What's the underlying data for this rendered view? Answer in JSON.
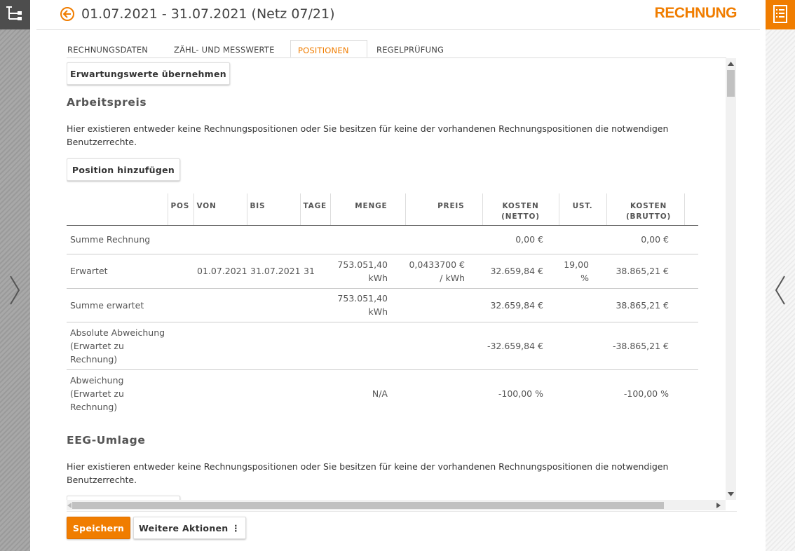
{
  "header": {
    "title": "01.07.2021 - 31.07.2021 (Netz 07/21)",
    "brand": "RECHNUNG",
    "accent_color": "#f07d00"
  },
  "tabs": [
    {
      "label": "RECHNUNGSDATEN",
      "active": false
    },
    {
      "label": "ZÄHL- UND MESSWERTE",
      "active": false
    },
    {
      "label": "POSITIONEN",
      "active": true
    },
    {
      "label": "REGELPRÜFUNG",
      "active": false
    }
  ],
  "content": {
    "apply_button": "Erwartungswerte übernehmen",
    "section1": {
      "title": "Arbeitspreis",
      "info_line1": "Hier existieren entweder keine Rechnungspositionen oder Sie besitzen für keine der vorhandenen Rechnungspositionen die notwendigen",
      "info_line2": "Benutzerrechte.",
      "add_button": "Position hinzufügen"
    },
    "table": {
      "headers": [
        "",
        "POS",
        "VON",
        "BIS",
        "TAGE",
        "MENGE",
        "PREIS",
        "KOSTEN (NETTO)",
        "UST.",
        "KOSTEN (BRUTTO)"
      ],
      "header_lines": {
        "netto1": "KOSTEN",
        "netto2": "(NETTO)",
        "brutto1": "KOSTEN",
        "brutto2": "(BRUTTO)"
      },
      "rows": [
        {
          "label": "Summe Rechnung",
          "pos": "",
          "von": "",
          "bis": "",
          "tage": "",
          "menge": "",
          "menge_unit": "",
          "preis": "",
          "preis_unit": "",
          "netto": "0,00 €",
          "ust": "",
          "ust_unit": "",
          "brutto": "0,00 €"
        },
        {
          "label": "Erwartet",
          "pos": "",
          "von": "01.07.2021",
          "bis": "31.07.2021",
          "tage": "31",
          "menge": "753.051,40",
          "menge_unit": "kWh",
          "preis": "0,0433700 €",
          "preis_unit": "/ kWh",
          "netto": "32.659,84 €",
          "ust": "19,00",
          "ust_unit": "%",
          "brutto": "38.865,21 €"
        },
        {
          "label": "Summe erwartet",
          "pos": "",
          "von": "",
          "bis": "",
          "tage": "",
          "menge": "753.051,40",
          "menge_unit": "kWh",
          "preis": "",
          "preis_unit": "",
          "netto": "32.659,84 €",
          "ust": "",
          "ust_unit": "",
          "brutto": "38.865,21 €"
        },
        {
          "label_lines": [
            "Absolute Abweichung",
            "(Erwartet zu",
            "Rechnung)"
          ],
          "menge": "",
          "netto": "-32.659,84 €",
          "brutto": "-38.865,21 €"
        },
        {
          "label_lines": [
            "Abweichung",
            "(Erwartet zu",
            "Rechnung)"
          ],
          "menge": "N/A",
          "netto": "-100,00 %",
          "brutto": "-100,00 %"
        }
      ]
    },
    "section2": {
      "title": "EEG-Umlage",
      "info_line1": "Hier existieren entweder keine Rechnungspositionen oder Sie besitzen für keine der vorhandenen Rechnungspositionen die notwendigen",
      "info_line2": "Benutzerrechte."
    }
  },
  "footer": {
    "save_button": "Speichern",
    "more_actions_button": "Weitere Aktionen ⋮"
  }
}
